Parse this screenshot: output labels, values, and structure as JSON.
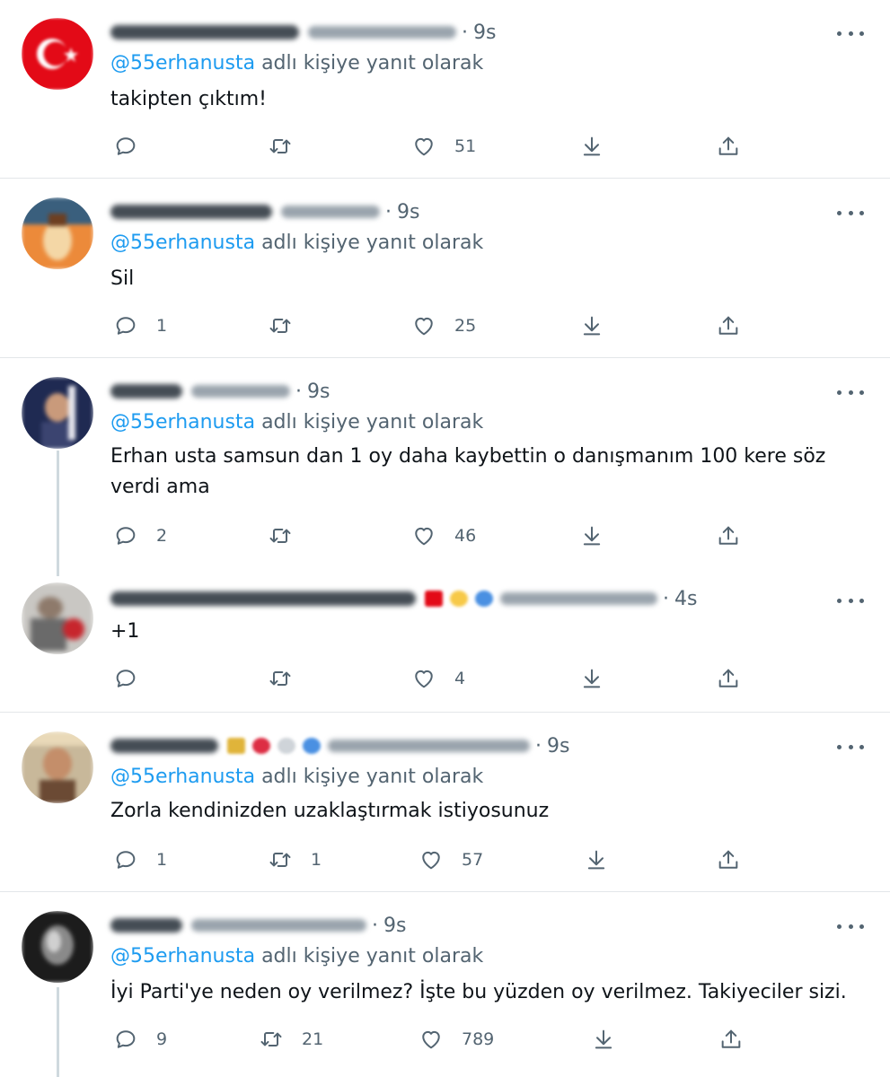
{
  "colors": {
    "accent": "#1d9bf0",
    "muted": "#536471",
    "text": "#0f1419",
    "divider": "#e3e6e9"
  },
  "icons": {
    "reply": "reply-icon",
    "retweet": "retweet-icon",
    "like": "heart-icon",
    "bookmark": "download-arrow-icon",
    "share": "share-icon",
    "more": "more-icon"
  },
  "reply_prefix": "adlı kişiye yanıt olarak",
  "tweets": [
    {
      "time": "9s",
      "mention": "@55erhanusta",
      "text": "takipten çıktım!",
      "replies": "",
      "retweets": "",
      "likes": "51"
    },
    {
      "time": "9s",
      "mention": "@55erhanusta",
      "text": "Sil",
      "replies": "1",
      "retweets": "",
      "likes": "25"
    },
    {
      "time": "9s",
      "mention": "@55erhanusta",
      "text": "Erhan usta samsun  dan 1 oy daha kaybettin o danışmanım 100 kere söz verdi ama",
      "replies": "2",
      "retweets": "",
      "likes": "46"
    },
    {
      "time": "4s",
      "text": "+1",
      "replies": "",
      "retweets": "",
      "likes": "4"
    },
    {
      "time": "9s",
      "mention": "@55erhanusta",
      "text": "Zorla kendinizden uzaklaştırmak istiyosunuz",
      "replies": "1",
      "retweets": "1",
      "likes": "57"
    },
    {
      "time": "9s",
      "mention": "@55erhanusta",
      "text": "İyi Parti'ye neden oy verilmez? İşte bu yüzden oy verilmez. Takiyeciler sizi.",
      "replies": "9",
      "retweets": "21",
      "likes": "789"
    }
  ]
}
